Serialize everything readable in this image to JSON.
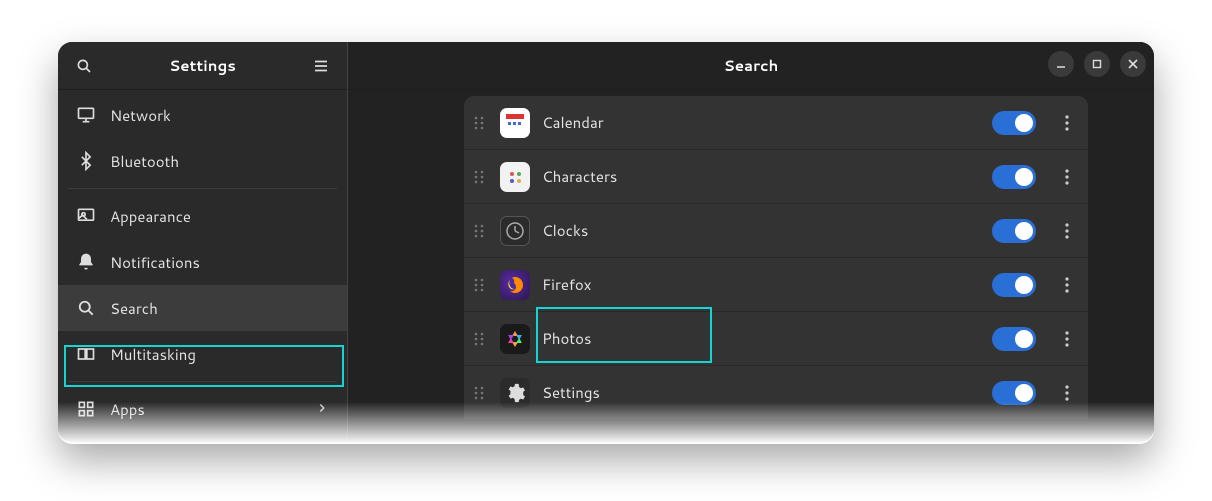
{
  "sidebar": {
    "title": "Settings",
    "items": [
      {
        "id": "network",
        "label": "Network"
      },
      {
        "id": "bluetooth",
        "label": "Bluetooth"
      },
      {
        "id": "appearance",
        "label": "Appearance"
      },
      {
        "id": "notifications",
        "label": "Notifications"
      },
      {
        "id": "search",
        "label": "Search",
        "selected": true
      },
      {
        "id": "multitasking",
        "label": "Multitasking"
      },
      {
        "id": "apps",
        "label": "Apps",
        "has_chevron": true
      }
    ]
  },
  "content": {
    "title": "Search",
    "rows": [
      {
        "name": "Calendar",
        "enabled": true,
        "icon": "calendar"
      },
      {
        "name": "Characters",
        "enabled": true,
        "icon": "characters"
      },
      {
        "name": "Clocks",
        "enabled": true,
        "icon": "clocks"
      },
      {
        "name": "Firefox",
        "enabled": true,
        "icon": "firefox",
        "highlighted": true
      },
      {
        "name": "Photos",
        "enabled": true,
        "icon": "photos"
      },
      {
        "name": "Settings",
        "enabled": true,
        "icon": "settings"
      }
    ]
  }
}
